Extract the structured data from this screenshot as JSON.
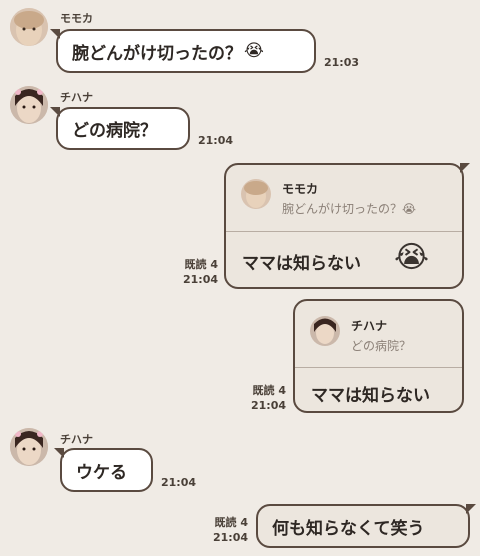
{
  "messages": [
    {
      "sender": "モモカ",
      "text": "腕どんがけ切ったの？",
      "emoji": "😭",
      "time": "21:03"
    },
    {
      "sender": "チハナ",
      "text": "どの病院？",
      "time": "21:04"
    },
    {
      "quote_sender": "モモカ",
      "quote_text": "腕どんがけ切ったの？",
      "quote_emoji": "😭",
      "text": "ママは知らない",
      "emoji": "😭",
      "read": "既読 4",
      "time": "21:04"
    },
    {
      "quote_sender": "チハナ",
      "quote_text": "どの病院？",
      "text": "ママは知らない",
      "read": "既読 4",
      "time": "21:04"
    },
    {
      "sender": "チハナ",
      "text": "ウケる",
      "time": "21:04"
    },
    {
      "text": "何も知らなくて笑う",
      "read": "既読 4",
      "time": "21:04"
    }
  ],
  "colors": {
    "background": "#f0ebe5",
    "bubble_border": "#5a4a40",
    "incoming": "#ffffff",
    "outgoing": "#ece6de"
  },
  "icons": {
    "emoji_crying": "😭"
  }
}
